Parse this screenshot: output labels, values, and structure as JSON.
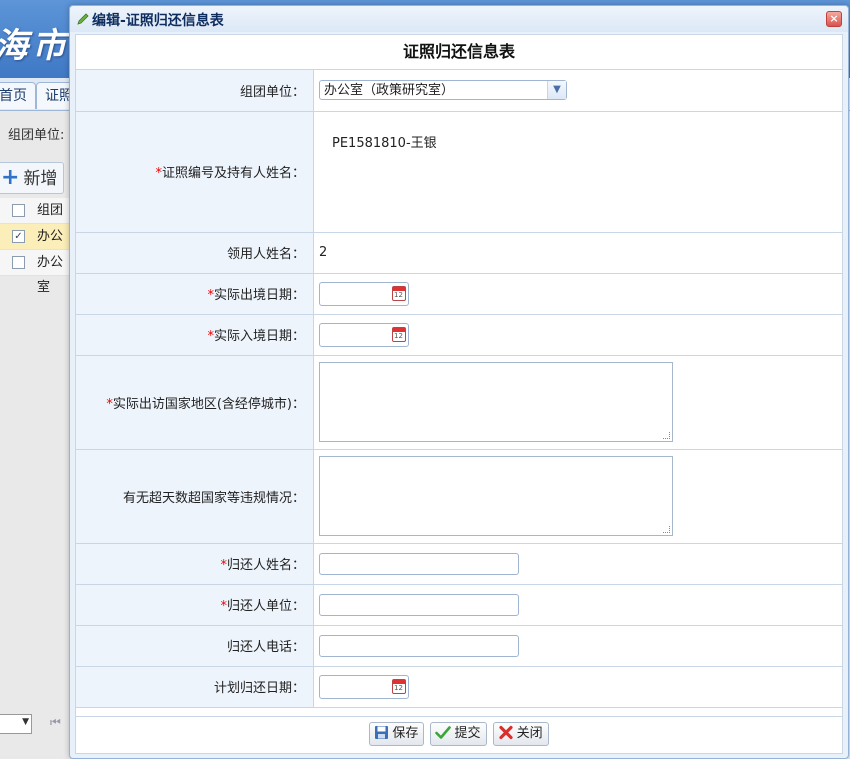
{
  "background": {
    "banner_text": "海市",
    "tabs": [
      "首页",
      "证照"
    ],
    "filter_label": "组团单位:",
    "add_button": "新增",
    "grid_header": "组团单",
    "rows": [
      {
        "text": "办公室",
        "checked": true
      },
      {
        "text": "办公室",
        "checked": false
      }
    ]
  },
  "dialog": {
    "title": "编辑-证照归还信息表",
    "form_title": "证照归还信息表",
    "fields": {
      "unit": {
        "label": "组团单位：",
        "value": "办公室（政策研究室）"
      },
      "cert": {
        "required": "*",
        "label": "证照编号及持有人姓名：",
        "value": "PE1581810-王银"
      },
      "borrower": {
        "label": "领用人姓名：",
        "value": "2"
      },
      "exit_date": {
        "required": "*",
        "label": "实际出境日期：",
        "value": ""
      },
      "entry_date": {
        "required": "*",
        "label": "实际入境日期：",
        "value": ""
      },
      "visit_region": {
        "required": "*",
        "label": "实际出访国家地区(含经停城市)：",
        "value": ""
      },
      "violation": {
        "label": "有无超天数超国家等违规情况：",
        "value": ""
      },
      "returner_name": {
        "required": "*",
        "label": "归还人姓名：",
        "value": ""
      },
      "returner_unit": {
        "required": "*",
        "label": "归还人单位：",
        "value": ""
      },
      "returner_phone": {
        "label": "归还人电话：",
        "value": ""
      },
      "plan_return_date": {
        "label": "计划归还日期：",
        "value": ""
      }
    },
    "buttons": {
      "save": "保存",
      "submit": "提交",
      "close": "关闭"
    }
  }
}
